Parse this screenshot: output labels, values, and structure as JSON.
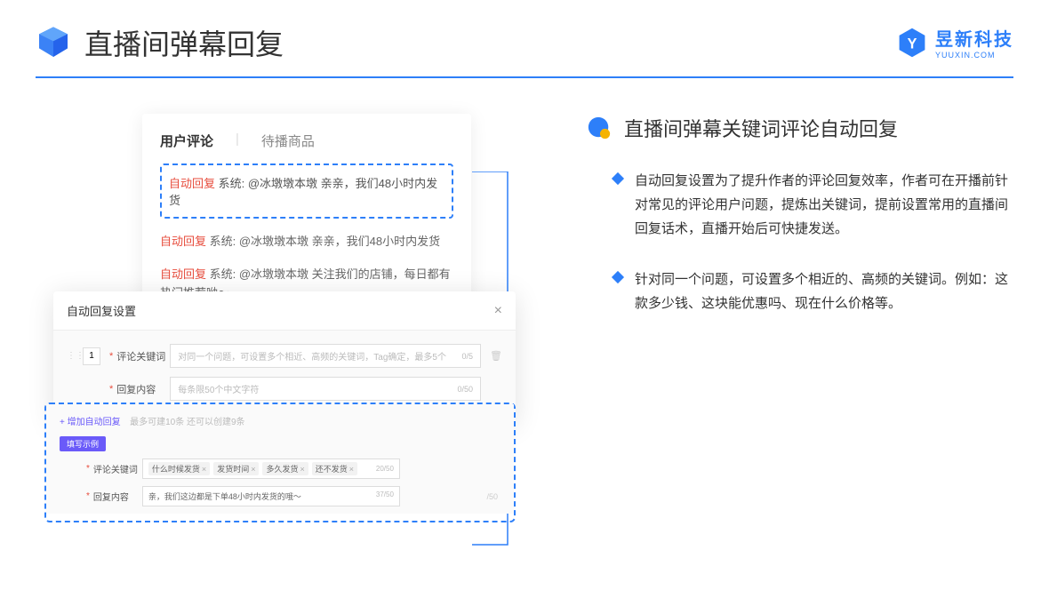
{
  "header": {
    "title": "直播间弹幕回复",
    "logo_text": "昱新科技",
    "logo_sub": "YUUXIN.COM"
  },
  "comments": {
    "tab_active": "用户评论",
    "tab_inactive": "待播商品",
    "highlight": {
      "tag": "自动回复",
      "text": "系统: @冰墩墩本墩 亲亲，我们48小时内发货"
    },
    "line2": {
      "tag": "自动回复",
      "text": "系统: @冰墩墩本墩 亲亲，我们48小时内发货"
    },
    "line3": {
      "tag": "自动回复",
      "text": "系统: @冰墩墩本墩 关注我们的店铺，每日都有热门推荐呦～"
    }
  },
  "modal": {
    "title": "自动回复设置",
    "row_num": "1",
    "keyword_label": "评论关键词",
    "keyword_placeholder": "对同一个问题，可设置多个相近、高频的关键词，Tag确定，最多5个",
    "keyword_counter": "0/5",
    "content_label": "回复内容",
    "content_placeholder": "每条限50个中文字符",
    "content_counter": "0/50"
  },
  "example": {
    "add_link": "+ 增加自动回复",
    "add_hint": "最多可建10条 还可以创建9条",
    "tag_label": "填写示例",
    "keyword_label": "评论关键词",
    "tags": [
      "什么时候发货",
      "发货时间",
      "多久发货",
      "还不发货"
    ],
    "tag_counter": "20/50",
    "content_label": "回复内容",
    "content_value": "亲，我们这边都是下单48小时内发货的哦～",
    "content_counter": "37/50",
    "side_counter": "/50"
  },
  "right": {
    "heading": "直播间弹幕关键词评论自动回复",
    "bullet1": "自动回复设置为了提升作者的评论回复效率，作者可在开播前针对常见的评论用户问题，提炼出关键词，提前设置常用的直播间回复话术，直播开始后可快捷发送。",
    "bullet2": "针对同一个问题，可设置多个相近的、高频的关键词。例如：这款多少钱、这块能优惠吗、现在什么价格等。"
  }
}
